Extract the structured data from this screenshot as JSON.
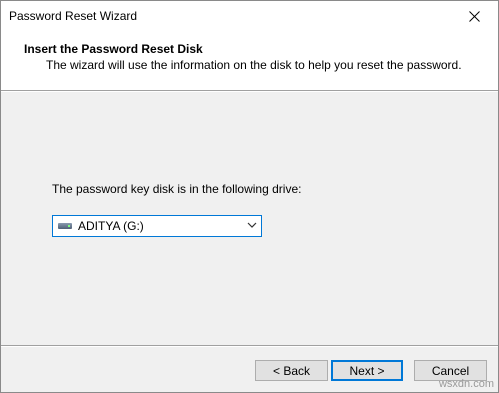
{
  "window": {
    "title": "Password Reset Wizard"
  },
  "header": {
    "title": "Insert the Password Reset Disk",
    "description": "The wizard will use the information on the disk to help you reset the password."
  },
  "main": {
    "drive_label": "The password key disk is in the following drive:",
    "drive_select": {
      "selected": "ADITYA (G:)",
      "icon": "removable-drive-icon"
    }
  },
  "buttons": {
    "back": "< Back",
    "next": "Next >",
    "cancel": "Cancel"
  },
  "watermark": "wsxdn.com",
  "colors": {
    "accent": "#0078d7",
    "dialog_bg": "#f0f0f0",
    "header_bg": "#ffffff"
  }
}
